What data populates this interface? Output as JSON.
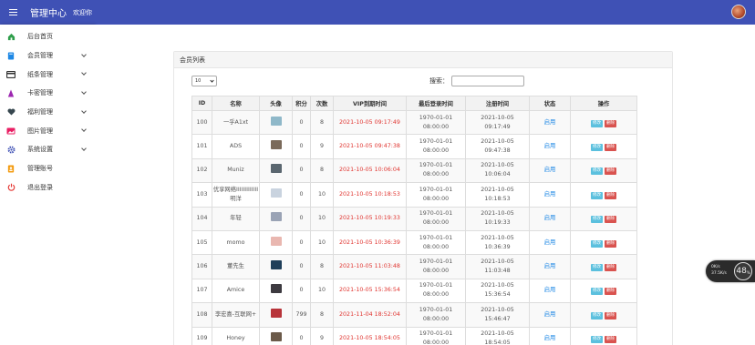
{
  "header": {
    "title": "管理中心",
    "welcome": "欢迎你"
  },
  "sidebar": {
    "items": [
      {
        "label": "后台首页",
        "icon": "home-icon",
        "color": "#2e9e4a",
        "expandable": false
      },
      {
        "label": "会员管理",
        "icon": "book-icon",
        "color": "#1e88e5",
        "expandable": true
      },
      {
        "label": "纸条管理",
        "icon": "card-icon",
        "color": "#333333",
        "expandable": true
      },
      {
        "label": "卡密管理",
        "icon": "triangle-icon",
        "color": "#9c27b0",
        "expandable": true
      },
      {
        "label": "福利管理",
        "icon": "heart-icon",
        "color": "#37474f",
        "expandable": true
      },
      {
        "label": "图片管理",
        "icon": "image-icon",
        "color": "#e91e63",
        "expandable": true
      },
      {
        "label": "系统设置",
        "icon": "gear-icon",
        "color": "#3f51b5",
        "expandable": true
      },
      {
        "label": "管理账号",
        "icon": "user-badge-icon",
        "color": "#f39c12",
        "expandable": false
      },
      {
        "label": "退出登录",
        "icon": "power-icon",
        "color": "#e53935",
        "expandable": false
      }
    ]
  },
  "panel": {
    "title": "会员列表",
    "page_length": "10",
    "search_label": "搜索：",
    "search_value": ""
  },
  "table": {
    "headers": [
      "ID",
      "名称",
      "头像",
      "积分",
      "次数",
      "VIP到期时间",
      "最后登录时间",
      "注册时间",
      "状态",
      "操作"
    ],
    "rows": [
      {
        "id": "100",
        "name": "一乎A1xt",
        "thumb_color": "#8fb8c9",
        "points": "0",
        "count": "8",
        "vip": "2021-10-05 09:17:49",
        "last_login": "1970-01-01 08:00:00",
        "register": "2021-10-05 09:17:49",
        "status": "启用",
        "edit": "修改",
        "delete": "删除"
      },
      {
        "id": "101",
        "name": "ADS",
        "thumb_color": "#7a6a5a",
        "points": "0",
        "count": "9",
        "vip": "2021-10-05 09:47:38",
        "last_login": "1970-01-01 08:00:00",
        "register": "2021-10-05 09:47:38",
        "status": "启用",
        "edit": "修改",
        "delete": "删除"
      },
      {
        "id": "102",
        "name": "Muniz",
        "thumb_color": "#5b6770",
        "points": "0",
        "count": "8",
        "vip": "2021-10-05 10:06:04",
        "last_login": "1970-01-01 08:00:00",
        "register": "2021-10-05 10:06:04",
        "status": "启用",
        "edit": "修改",
        "delete": "删除"
      },
      {
        "id": "103",
        "name": "优享网络IIIIIIIIIIIII明洋",
        "thumb_color": "#c9d3df",
        "points": "0",
        "count": "10",
        "vip": "2021-10-05 10:18:53",
        "last_login": "1970-01-01 08:00:00",
        "register": "2021-10-05 10:18:53",
        "status": "启用",
        "edit": "修改",
        "delete": "删除"
      },
      {
        "id": "104",
        "name": "年轻",
        "thumb_color": "#9aa3b5",
        "points": "0",
        "count": "10",
        "vip": "2021-10-05 10:19:33",
        "last_login": "1970-01-01 08:00:00",
        "register": "2021-10-05 10:19:33",
        "status": "启用",
        "edit": "修改",
        "delete": "删除"
      },
      {
        "id": "105",
        "name": "momo",
        "thumb_color": "#e9b7b0",
        "points": "0",
        "count": "10",
        "vip": "2021-10-05 10:36:39",
        "last_login": "1970-01-01 08:00:00",
        "register": "2021-10-05 10:36:39",
        "status": "启用",
        "edit": "修改",
        "delete": "删除"
      },
      {
        "id": "106",
        "name": "董先生",
        "thumb_color": "#1f3f5a",
        "points": "0",
        "count": "8",
        "vip": "2021-10-05 11:03:48",
        "last_login": "1970-01-01 08:00:00",
        "register": "2021-10-05 11:03:48",
        "status": "启用",
        "edit": "修改",
        "delete": "删除"
      },
      {
        "id": "107",
        "name": "Amice",
        "thumb_color": "#3d3a40",
        "points": "0",
        "count": "10",
        "vip": "2021-10-05 15:36:54",
        "last_login": "1970-01-01 08:00:00",
        "register": "2021-10-05 15:36:54",
        "status": "启用",
        "edit": "修改",
        "delete": "删除"
      },
      {
        "id": "108",
        "name": "李宏喜-互联网+",
        "thumb_color": "#b8343a",
        "points": "799",
        "count": "8",
        "vip": "2021-11-04 18:52:04",
        "last_login": "1970-01-01 08:00:00",
        "register": "2021-10-05 15:46:47",
        "status": "启用",
        "edit": "修改",
        "delete": "删除"
      },
      {
        "id": "109",
        "name": "Honey",
        "thumb_color": "#6b5a4a",
        "points": "0",
        "count": "9",
        "vip": "2021-10-05 18:54:05",
        "last_login": "1970-01-01 08:00:00",
        "register": "2021-10-05 18:54:05",
        "status": "启用",
        "edit": "修改",
        "delete": "删除"
      }
    ]
  },
  "widget": {
    "up": "0K/s",
    "down": "37.5K/s",
    "percent": "48",
    "percent_unit": "%"
  }
}
